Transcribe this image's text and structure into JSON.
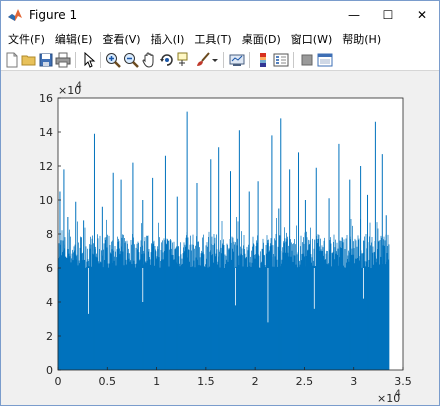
{
  "window": {
    "title": "Figure 1",
    "minimize_glyph": "—",
    "maximize_glyph": "☐",
    "close_glyph": "✕"
  },
  "menu": {
    "items": [
      "文件(F)",
      "编辑(E)",
      "查看(V)",
      "插入(I)",
      "工具(T)",
      "桌面(D)",
      "窗口(W)",
      "帮助(H)"
    ]
  },
  "toolbar": {
    "icons": [
      "new-figure-icon",
      "open-file-icon",
      "save-icon",
      "print-icon",
      "pointer-icon",
      "zoom-in-icon",
      "zoom-out-icon",
      "pan-icon",
      "rotate-3d-icon",
      "data-cursor-icon",
      "brush-icon",
      "brush-dropdown-icon",
      "link-plot-icon",
      "colorbar-icon",
      "legend-icon",
      "hide-plot-tools-icon",
      "show-plot-tools-icon"
    ]
  },
  "colors": {
    "bar": "#0072BD",
    "axes_bg": "#ffffff",
    "figure_bg": "#f0f0f0"
  },
  "chart_data": {
    "type": "bar",
    "title": "",
    "xlabel": "",
    "ylabel": "",
    "xlim": [
      0,
      35000
    ],
    "ylim": [
      0,
      160000
    ],
    "x_exponent": "×10",
    "x_exponent_power": "4",
    "y_exponent": "×10",
    "y_exponent_power": "4",
    "xticks": [
      0,
      5000,
      10000,
      15000,
      20000,
      25000,
      30000,
      35000
    ],
    "xtick_labels": [
      "0",
      "0.5",
      "1",
      "1.5",
      "2",
      "2.5",
      "3",
      "3.5"
    ],
    "yticks": [
      0,
      20000,
      40000,
      60000,
      80000,
      100000,
      120000,
      140000,
      160000
    ],
    "ytick_labels": [
      "0",
      "2",
      "4",
      "6",
      "8",
      "10",
      "12",
      "14",
      "16"
    ],
    "n_points": 33600,
    "typical_band": [
      60000,
      80000
    ],
    "spikes": [
      {
        "x": 200,
        "y": 105000
      },
      {
        "x": 600,
        "y": 118000
      },
      {
        "x": 1000,
        "y": 90000
      },
      {
        "x": 1800,
        "y": 99000
      },
      {
        "x": 2600,
        "y": 88000
      },
      {
        "x": 3700,
        "y": 139000
      },
      {
        "x": 4500,
        "y": 96000
      },
      {
        "x": 5600,
        "y": 116000
      },
      {
        "x": 6400,
        "y": 112000
      },
      {
        "x": 7600,
        "y": 122000
      },
      {
        "x": 8600,
        "y": 100000
      },
      {
        "x": 9600,
        "y": 113000
      },
      {
        "x": 10900,
        "y": 126000
      },
      {
        "x": 12100,
        "y": 102000
      },
      {
        "x": 13100,
        "y": 152000
      },
      {
        "x": 14100,
        "y": 110000
      },
      {
        "x": 15500,
        "y": 124000
      },
      {
        "x": 16300,
        "y": 131000
      },
      {
        "x": 17500,
        "y": 117000
      },
      {
        "x": 18400,
        "y": 141000
      },
      {
        "x": 19400,
        "y": 105000
      },
      {
        "x": 20300,
        "y": 111000
      },
      {
        "x": 21700,
        "y": 138000
      },
      {
        "x": 22400,
        "y": 95000
      },
      {
        "x": 22600,
        "y": 148000
      },
      {
        "x": 23500,
        "y": 118000
      },
      {
        "x": 24400,
        "y": 128000
      },
      {
        "x": 25100,
        "y": 100000
      },
      {
        "x": 26200,
        "y": 119000
      },
      {
        "x": 27500,
        "y": 101000
      },
      {
        "x": 28500,
        "y": 133000
      },
      {
        "x": 29600,
        "y": 112000
      },
      {
        "x": 30700,
        "y": 120000
      },
      {
        "x": 31400,
        "y": 103000
      },
      {
        "x": 32200,
        "y": 146000
      },
      {
        "x": 32900,
        "y": 127000
      },
      {
        "x": 33300,
        "y": 91000
      }
    ],
    "dips": [
      {
        "x": 3100,
        "y": 33000
      },
      {
        "x": 8600,
        "y": 40000
      },
      {
        "x": 18000,
        "y": 38000
      },
      {
        "x": 21300,
        "y": 28000
      },
      {
        "x": 26000,
        "y": 36000
      },
      {
        "x": 31000,
        "y": 42000
      }
    ]
  }
}
